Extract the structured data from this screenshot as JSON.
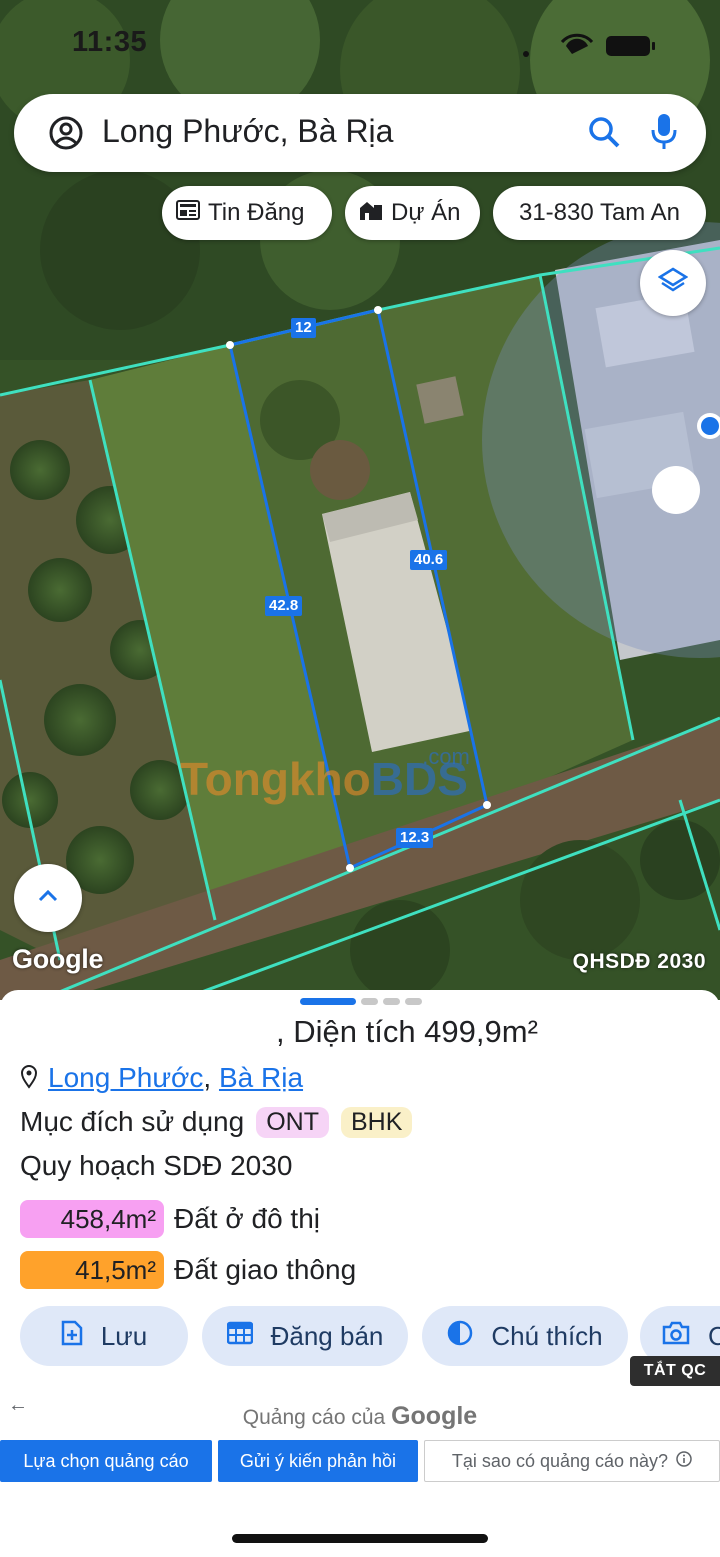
{
  "status_bar": {
    "time": "11:35"
  },
  "search": {
    "query": "Long Phước, Bà Rịa"
  },
  "chips": [
    {
      "label": "Tin Đăng",
      "icon": "newspaper-icon"
    },
    {
      "label": "Dự Án",
      "icon": "building-icon"
    },
    {
      "label": "31-830 Tam An",
      "icon": ""
    }
  ],
  "map": {
    "dimensions": {
      "top": "12",
      "left": "42.8",
      "right": "40.6",
      "bottom": "12.3"
    },
    "google_logo": "Google",
    "layer_label": "QHSDĐ 2030",
    "watermark": {
      "main": "Tongkho",
      "brand": "BDS",
      "suffix": ".com"
    }
  },
  "sheet": {
    "title_suffix": ", Diện tích 499,9m²",
    "location": {
      "ward": "Long Phước",
      "separator": ",",
      "city": "Bà Rịa"
    },
    "purpose_label": "Mục đích sử dụng",
    "purpose_tags": [
      "ONT",
      "BHK"
    ],
    "plan_label": "Quy hoạch SDĐ 2030",
    "zones": [
      {
        "area": "458,4m²",
        "label": "Đất ở đô thị",
        "color": "#f7a0f2"
      },
      {
        "area": "41,5m²",
        "label": "Đất giao thông",
        "color": "#ffa22b"
      }
    ],
    "actions": [
      {
        "label": "Lưu",
        "icon": "add-file-icon"
      },
      {
        "label": "Đăng bán",
        "icon": "calendar-grid-icon"
      },
      {
        "label": "Chú thích",
        "icon": "half-circle-icon"
      },
      {
        "label": "C",
        "icon": "camera-icon"
      }
    ],
    "ad_close": "TẮT QC"
  },
  "ads": {
    "label_prefix": "Quảng cáo của",
    "label_brand": "Google",
    "buttons": [
      "Lựa chọn quảng cáo",
      "Gửi ý kiến phản hồi",
      "Tại sao có quảng cáo này?"
    ]
  }
}
